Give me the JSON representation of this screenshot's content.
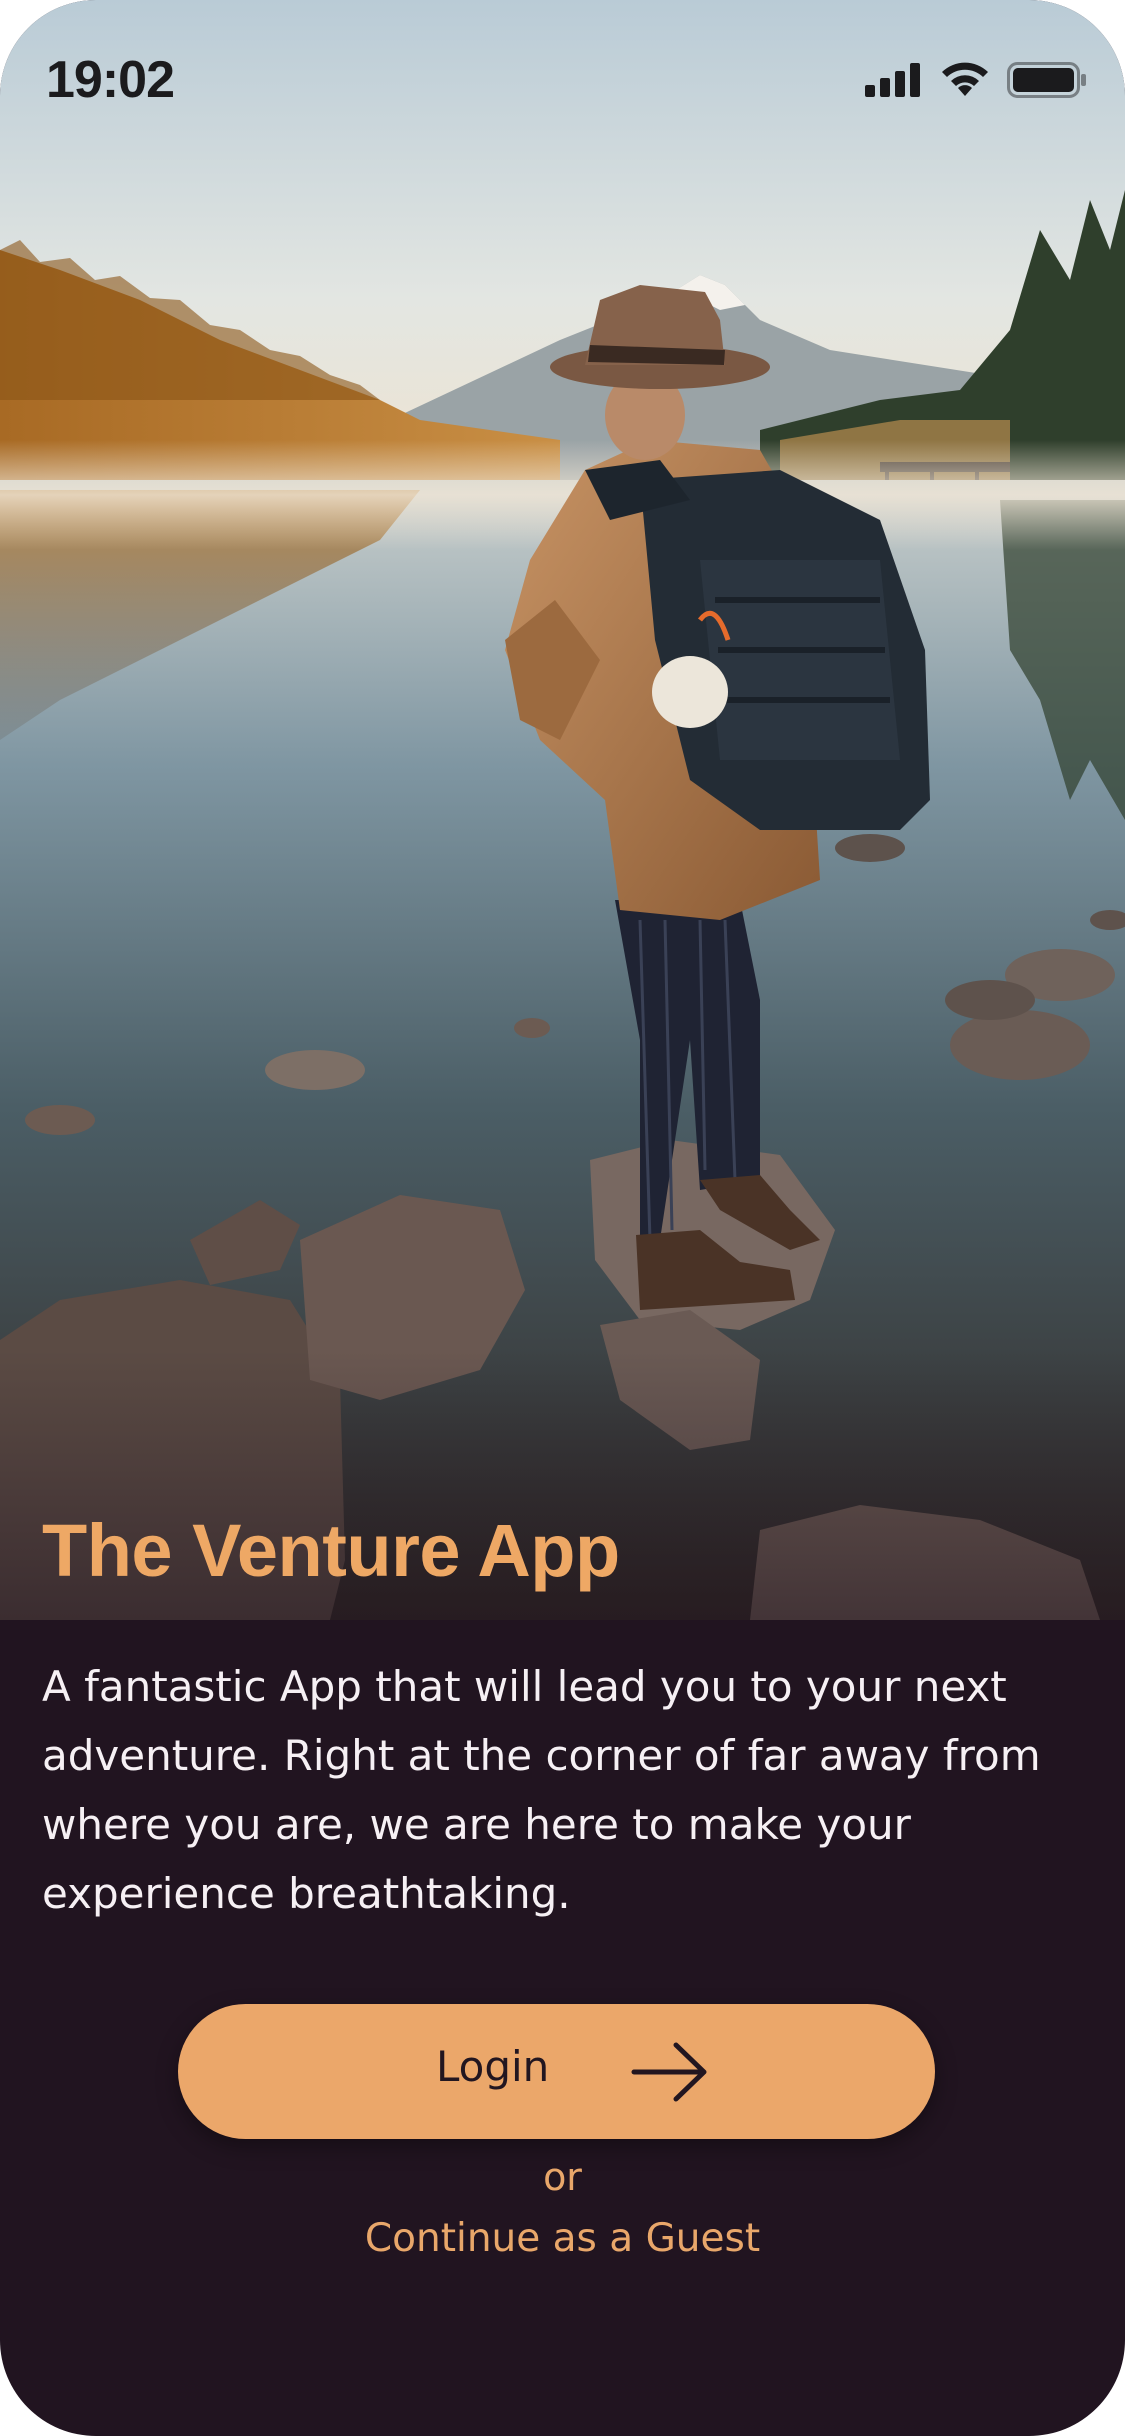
{
  "status_bar": {
    "time": "19:02",
    "icons": [
      "cellular-signal-icon",
      "wifi-icon",
      "battery-icon"
    ]
  },
  "hero": {
    "image": "hiker-at-mountain-lake-photo"
  },
  "app": {
    "title": "The Venture App",
    "description": "A fantastic App that will lead you to your next adventure. Right at the corner of far away from where you are, we are here to make your experience breathtaking."
  },
  "actions": {
    "login_label": "Login",
    "login_icon": "arrow-right-icon",
    "or_label": "or",
    "guest_label": "Continue as a Guest"
  },
  "colors": {
    "accent": "#EBA76A",
    "background": "#211420",
    "text": "#F6F0F4",
    "button_text": "#221620"
  }
}
